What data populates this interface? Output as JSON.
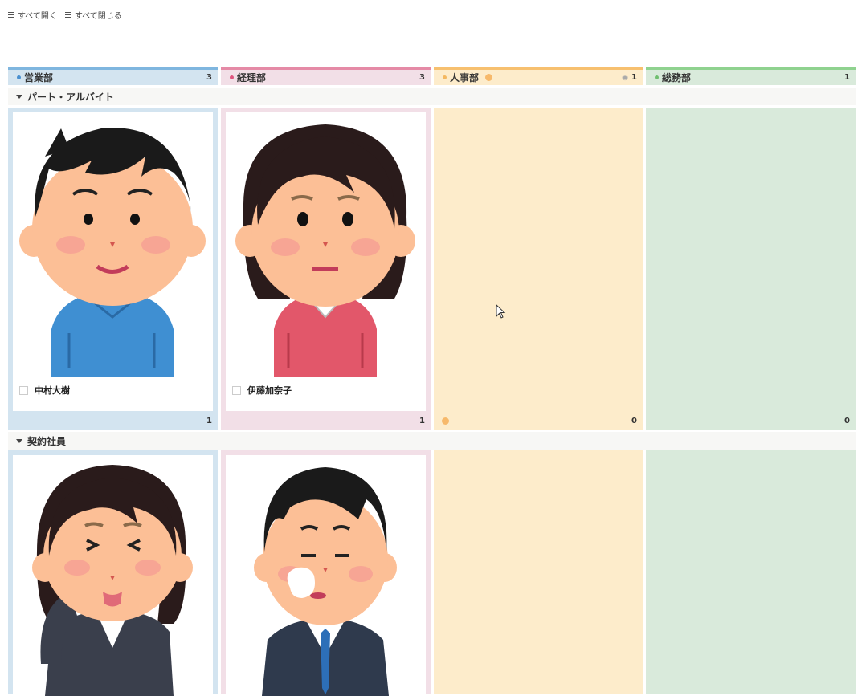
{
  "toolbar": {
    "expand_all": "すべて開く",
    "collapse_all": "すべて閉じる"
  },
  "columns": [
    {
      "name": "営業部",
      "count": "3",
      "color": "#7fb6df",
      "bg": "#d3e4f0"
    },
    {
      "name": "経理部",
      "count": "3",
      "color": "#e58aa6",
      "bg": "#f2dfe7"
    },
    {
      "name": "人事部",
      "count": "1",
      "color": "#f7c06f",
      "bg": "#fdeccb"
    },
    {
      "name": "総務部",
      "count": "1",
      "color": "#8fd28f",
      "bg": "#d9eadb"
    }
  ],
  "groups": [
    {
      "name": "パート・アルバイト",
      "cells": [
        {
          "count": "1",
          "card": {
            "name": "中村大樹",
            "avatar": "boy-blue-sweater"
          }
        },
        {
          "count": "1",
          "card": {
            "name": "伊藤加奈子",
            "avatar": "girl-red-sweater"
          }
        },
        {
          "count": "0"
        },
        {
          "count": "0"
        }
      ]
    },
    {
      "name": "契約社員",
      "cells": [
        {
          "card": {
            "avatar": "woman-suit-tongue"
          }
        },
        {
          "card": {
            "avatar": "man-suit-sigh"
          }
        },
        {},
        {}
      ]
    }
  ]
}
